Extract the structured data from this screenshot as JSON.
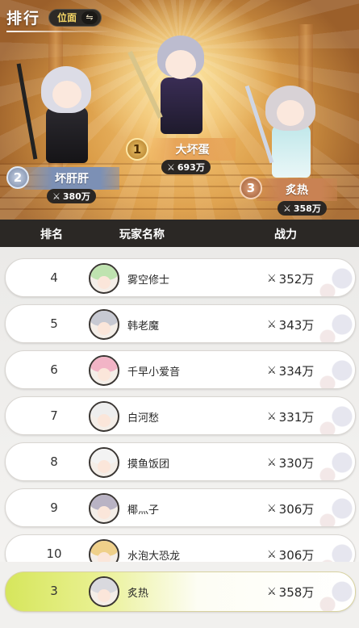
{
  "header": {
    "title": "排行",
    "switch_label": "位面",
    "switch_icon": "swap-icon"
  },
  "podium": [
    {
      "place": "1",
      "name": "大坏蛋",
      "power": "693万",
      "color": "#e7a55a"
    },
    {
      "place": "2",
      "name": "坏肝肝",
      "power": "380万",
      "color": "#7c90b5"
    },
    {
      "place": "3",
      "name": "炙热",
      "power": "358万",
      "color": "#c98253"
    }
  ],
  "columns": {
    "rank": "排名",
    "name": "玩家名称",
    "power": "战力"
  },
  "rows": [
    {
      "rank": "4",
      "name": "雾空修士",
      "power": "352万",
      "hair": "#bfe3b0"
    },
    {
      "rank": "5",
      "name": "韩老魔",
      "power": "343万",
      "hair": "#c7c9d2"
    },
    {
      "rank": "6",
      "name": "千早小爱音",
      "power": "334万",
      "hair": "#f2b4c6"
    },
    {
      "rank": "7",
      "name": "白河愁",
      "power": "331万",
      "hair": "#eeeeee"
    },
    {
      "rank": "8",
      "name": "摸鱼饭团",
      "power": "330万",
      "hair": "#f3f3f3"
    },
    {
      "rank": "9",
      "name": "椰灬子",
      "power": "306万",
      "hair": "#b9b3c4"
    },
    {
      "rank": "10",
      "name": "水泡大恐龙",
      "power": "306万",
      "hair": "#efd08a"
    }
  ],
  "self": {
    "rank": "3",
    "name": "炙热",
    "power": "358万",
    "hair": "#d9d9de"
  },
  "power_icon": "crossed-swords-icon",
  "accent": "#2b2825"
}
